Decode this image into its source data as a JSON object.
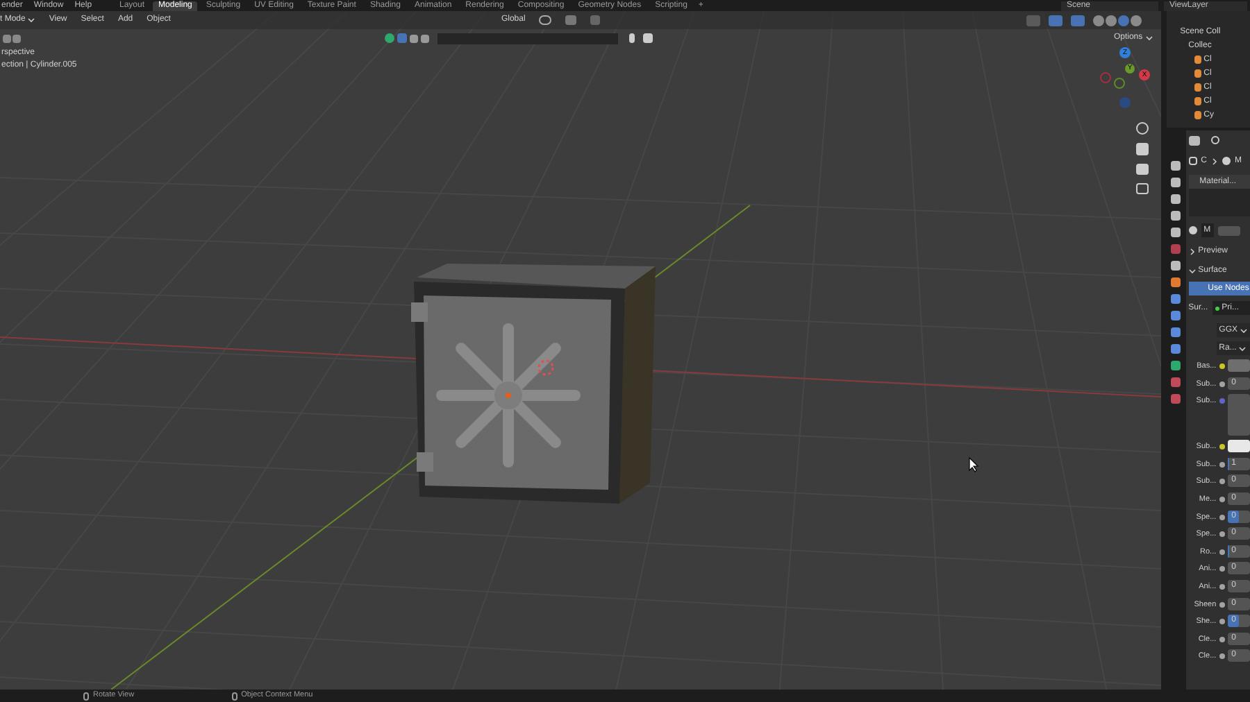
{
  "top_bar": {
    "menus": [
      "ender",
      "Window",
      "Help"
    ],
    "workspaces": [
      {
        "label": "Layout",
        "selected": false
      },
      {
        "label": "Modeling",
        "selected": true
      },
      {
        "label": "Sculpting",
        "selected": false
      },
      {
        "label": "UV Editing",
        "selected": false
      },
      {
        "label": "Texture Paint",
        "selected": false
      },
      {
        "label": "Shading",
        "selected": false
      },
      {
        "label": "Animation",
        "selected": false
      },
      {
        "label": "Rendering",
        "selected": false
      },
      {
        "label": "Compositing",
        "selected": false
      },
      {
        "label": "Geometry Nodes",
        "selected": false
      },
      {
        "label": "Scripting",
        "selected": false
      }
    ],
    "add_tab": "+",
    "scene": "Scene",
    "view_layer": "ViewLayer"
  },
  "viewport_header": {
    "mode": "t Mode",
    "menus": [
      "View",
      "Select",
      "Add",
      "Object"
    ],
    "orientation": "Global",
    "toggles": [
      {
        "on": false
      },
      {
        "on": true
      },
      {
        "on": true
      }
    ],
    "shading_modes": [
      {
        "selected": false
      },
      {
        "selected": false
      },
      {
        "selected": true
      },
      {
        "selected": false
      }
    ],
    "options": "Options"
  },
  "viewport": {
    "info": [
      "rspective",
      "ection | Cylinder.005"
    ],
    "gizmo": {
      "z": "Z",
      "y": "Y",
      "x": "X"
    }
  },
  "outliner": {
    "root": "Scene Coll",
    "collection": "Collec",
    "items": [
      "Cl",
      "Cl",
      "Cl",
      "Cl",
      "Cy"
    ]
  },
  "properties": {
    "breadcrumb": [
      "C",
      "M"
    ],
    "slot": "Material...",
    "material_name": "M",
    "panels": [
      {
        "label": "Preview",
        "expanded": false
      },
      {
        "label": "Surface",
        "expanded": true
      }
    ],
    "use_nodes": "Use Nodes",
    "surface_label": "Sur...",
    "surface_value": "Pri...",
    "distribution": "GGX",
    "subsurface_method": "Ra...",
    "rows": [
      {
        "label": "Bas...",
        "kind": "color",
        "color": "#c7c729",
        "swatch": {
          "color": "#6e6e6e"
        }
      },
      {
        "label": "Sub...",
        "kind": "number",
        "color": "#a1a1a1",
        "value": "0"
      },
      {
        "label": "Sub...",
        "kind": "vector",
        "color": "#6363c7"
      },
      {
        "label": "Sub...",
        "kind": "color",
        "color": "#c7c729",
        "swatch": {
          "color": "#e8e8e8"
        }
      },
      {
        "label": "Sub...",
        "kind": "number",
        "color": "#a1a1a1",
        "value": "1",
        "level": 0.05
      },
      {
        "label": "Sub...",
        "kind": "number",
        "color": "#a1a1a1",
        "value": "0"
      },
      {
        "label": "Me...",
        "kind": "number",
        "color": "#a1a1a1",
        "value": "0"
      },
      {
        "label": "Spe...",
        "kind": "number",
        "color": "#a1a1a1",
        "value": "0",
        "level": 0.5
      },
      {
        "label": "Spe...",
        "kind": "number",
        "color": "#a1a1a1",
        "value": "0"
      },
      {
        "label": "Ro...",
        "kind": "number",
        "color": "#a1a1a1",
        "value": "0",
        "level": 0.05
      },
      {
        "label": "Ani...",
        "kind": "number",
        "color": "#a1a1a1",
        "value": "0"
      },
      {
        "label": "Ani...",
        "kind": "number",
        "color": "#a1a1a1",
        "value": "0"
      },
      {
        "label": "Sheen",
        "kind": "number",
        "color": "#a1a1a1",
        "value": "0"
      },
      {
        "label": "She...",
        "kind": "number",
        "color": "#a1a1a1",
        "value": "0",
        "level": 0.5
      },
      {
        "label": "Cle...",
        "kind": "number",
        "color": "#a1a1a1",
        "value": "0"
      },
      {
        "label": "Cle...",
        "kind": "number",
        "color": "#a1a1a1",
        "value": "0"
      }
    ]
  },
  "status_bar": [
    "Rotate View",
    "Object Context Menu"
  ]
}
